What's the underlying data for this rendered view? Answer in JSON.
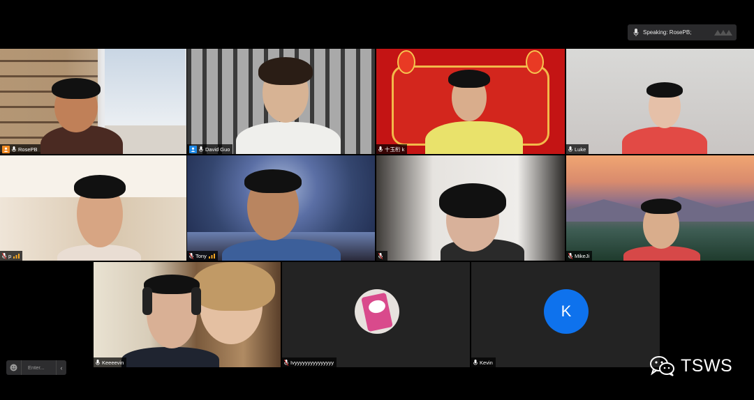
{
  "speaking_indicator": {
    "label": "Speaking: RosePB;"
  },
  "participants": [
    {
      "name": "RosePB"
    },
    {
      "name": "David Guo"
    },
    {
      "name": "十玉桁 k"
    },
    {
      "name": "Luke"
    },
    {
      "name": "p"
    },
    {
      "name": "Tony"
    },
    {
      "name": ""
    },
    {
      "name": "MikeJi"
    },
    {
      "name": "Keeeevin"
    },
    {
      "name": "Ivyyyyyyyyyyyyyyy"
    },
    {
      "name": "Kevin",
      "avatar_letter": "K"
    }
  ],
  "chat": {
    "placeholder": "Enter..."
  },
  "watermark": {
    "text": "TSWS",
    "icon": "wechat-icon"
  },
  "colors": {
    "active_speaker_border": "#23d160",
    "avatar_blue": "#0e72ed",
    "host_badge": "#f08a24"
  }
}
